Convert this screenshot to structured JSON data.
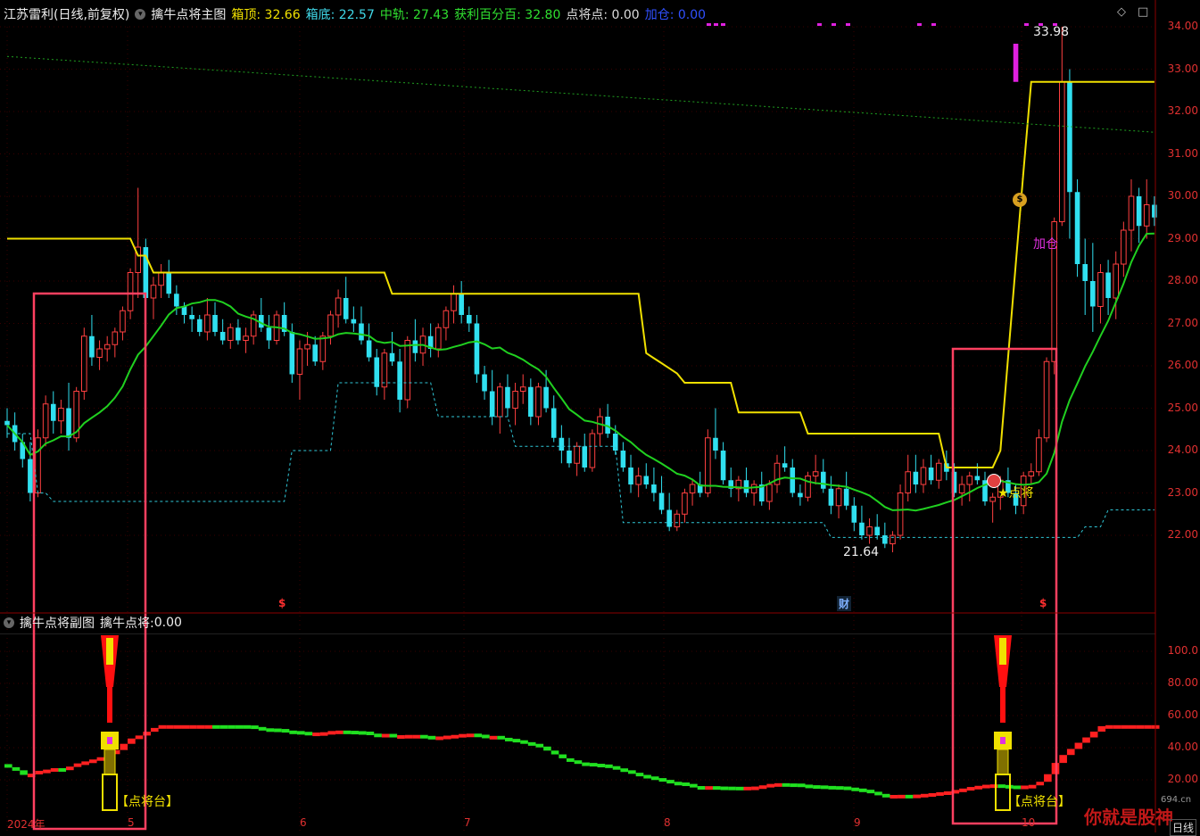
{
  "header": {
    "title": "江苏雷利(日线,前复权)",
    "indicator": "擒牛点将主图",
    "fields": [
      {
        "label": "箱顶: ",
        "value": "32.66",
        "color": "#f0e000"
      },
      {
        "label": "箱底: ",
        "value": "22.57",
        "color": "#40d8e8"
      },
      {
        "label": "中轨: ",
        "value": "27.43",
        "color": "#30e030"
      },
      {
        "label": "获利百分百: ",
        "value": "32.80",
        "color": "#30e030"
      },
      {
        "label": "点将点: ",
        "value": "0.00",
        "color": "#dddddd"
      },
      {
        "label": "加仓: ",
        "value": "0.00",
        "color": "#3050ff"
      }
    ]
  },
  "controls": {
    "diamond_icon": "◇",
    "square_icon": "□"
  },
  "sub": {
    "title": "擒牛点将副图",
    "field_label": "擒牛点将: ",
    "field_value": "0.00"
  },
  "annotations": {
    "high_label": "33.98",
    "low_label": "21.64",
    "dianjiang": "★点将",
    "jiacang": "加仓",
    "dianjiangtai_1": "【点将台】",
    "dianjiangtai_2": "【点将台】",
    "cai": "财",
    "dollar_1": "$",
    "dollar_2": "$",
    "coin_icon": "$"
  },
  "yaxis_main": [
    "34.00",
    "33.00",
    "32.00",
    "31.00",
    "30.00",
    "29.00",
    "28.00",
    "27.00",
    "26.00",
    "25.00",
    "24.00",
    "23.00",
    "22.00"
  ],
  "yaxis_sub": [
    "100.0",
    "80.00",
    "60.00",
    "40.00",
    "20.00"
  ],
  "xaxis": [
    {
      "label": "2024年"
    },
    {
      "label": "5"
    },
    {
      "label": "6"
    },
    {
      "label": "7"
    },
    {
      "label": "8"
    },
    {
      "label": "9"
    },
    {
      "label": "10"
    }
  ],
  "timeframe": "日线",
  "watermark": {
    "text": "你就是股神",
    "site": "694.cn"
  },
  "colors": {
    "up": "#ff4040",
    "down": "#30e0f0",
    "box_top": "#f0e000",
    "mid": "#20d020",
    "box_bottom": "#30c8d8",
    "grid": "#8b0000",
    "highlight": "#ff4060"
  },
  "chart_data": {
    "type": "candlestick",
    "ylim": [
      21.2,
      34.4
    ],
    "series": [
      {
        "name": "箱顶",
        "kind": "line"
      },
      {
        "name": "箱底",
        "kind": "line"
      },
      {
        "name": "中轨",
        "kind": "line"
      }
    ],
    "ohlc": [
      [
        24.7,
        25.0,
        24.3,
        24.6
      ],
      [
        24.6,
        24.9,
        24.0,
        24.2
      ],
      [
        24.2,
        24.4,
        23.6,
        23.8
      ],
      [
        23.8,
        24.2,
        22.8,
        23.0
      ],
      [
        23.0,
        24.5,
        22.9,
        24.3
      ],
      [
        24.3,
        25.3,
        24.1,
        25.1
      ],
      [
        25.1,
        25.4,
        24.4,
        24.7
      ],
      [
        24.7,
        25.2,
        24.4,
        25.0
      ],
      [
        25.0,
        25.6,
        24.0,
        24.3
      ],
      [
        24.3,
        25.5,
        24.2,
        25.4
      ],
      [
        25.4,
        26.9,
        25.2,
        26.7
      ],
      [
        26.7,
        27.2,
        26.0,
        26.2
      ],
      [
        26.2,
        26.6,
        25.9,
        26.4
      ],
      [
        26.4,
        26.7,
        26.1,
        26.5
      ],
      [
        26.5,
        26.9,
        26.2,
        26.8
      ],
      [
        26.8,
        27.4,
        26.6,
        27.3
      ],
      [
        27.3,
        28.3,
        27.1,
        28.2
      ],
      [
        28.2,
        30.2,
        27.6,
        28.8
      ],
      [
        28.8,
        29.0,
        27.2,
        27.6
      ],
      [
        27.6,
        28.1,
        27.1,
        27.9
      ],
      [
        27.9,
        28.4,
        27.6,
        28.2
      ],
      [
        28.2,
        28.5,
        27.6,
        27.7
      ],
      [
        27.7,
        27.9,
        27.2,
        27.4
      ],
      [
        27.4,
        27.5,
        27.0,
        27.2
      ],
      [
        27.2,
        27.4,
        26.8,
        27.1
      ],
      [
        27.1,
        27.2,
        26.7,
        26.8
      ],
      [
        26.8,
        27.6,
        26.6,
        27.2
      ],
      [
        27.2,
        27.5,
        26.7,
        26.8
      ],
      [
        26.8,
        27.1,
        26.5,
        26.6
      ],
      [
        26.6,
        27.0,
        26.4,
        26.9
      ],
      [
        26.9,
        27.1,
        26.5,
        26.6
      ],
      [
        26.6,
        26.9,
        26.3,
        26.7
      ],
      [
        26.7,
        27.3,
        26.5,
        27.2
      ],
      [
        27.2,
        27.6,
        26.8,
        26.9
      ],
      [
        26.9,
        27.2,
        26.4,
        26.6
      ],
      [
        26.6,
        27.3,
        26.5,
        27.2
      ],
      [
        27.2,
        27.5,
        26.7,
        26.8
      ],
      [
        26.8,
        27.0,
        25.6,
        25.8
      ],
      [
        25.8,
        26.6,
        25.2,
        26.4
      ],
      [
        26.4,
        26.8,
        26.0,
        26.5
      ],
      [
        26.5,
        26.7,
        26.0,
        26.1
      ],
      [
        26.1,
        26.8,
        25.9,
        26.7
      ],
      [
        26.7,
        27.3,
        26.5,
        27.2
      ],
      [
        27.2,
        27.8,
        26.9,
        27.6
      ],
      [
        27.6,
        28.1,
        27.0,
        27.1
      ],
      [
        27.1,
        27.4,
        26.8,
        27.0
      ],
      [
        27.0,
        27.4,
        26.5,
        26.6
      ],
      [
        26.6,
        27.0,
        26.1,
        26.2
      ],
      [
        26.2,
        26.4,
        25.3,
        25.5
      ],
      [
        25.5,
        26.4,
        25.2,
        26.3
      ],
      [
        26.3,
        26.8,
        26.0,
        26.1
      ],
      [
        26.1,
        26.4,
        24.9,
        25.2
      ],
      [
        25.2,
        26.7,
        25.0,
        26.6
      ],
      [
        26.6,
        27.1,
        26.1,
        26.3
      ],
      [
        26.3,
        26.9,
        26.0,
        26.7
      ],
      [
        26.7,
        27.0,
        26.2,
        26.4
      ],
      [
        26.4,
        27.0,
        26.2,
        26.9
      ],
      [
        26.9,
        27.4,
        26.6,
        27.3
      ],
      [
        27.3,
        27.9,
        27.0,
        27.7
      ],
      [
        27.7,
        28.0,
        27.0,
        27.2
      ],
      [
        27.2,
        27.4,
        26.8,
        27.0
      ],
      [
        27.0,
        27.2,
        25.6,
        25.8
      ],
      [
        25.8,
        26.0,
        25.2,
        25.4
      ],
      [
        25.4,
        25.9,
        24.6,
        24.8
      ],
      [
        24.8,
        25.6,
        24.4,
        25.5
      ],
      [
        25.5,
        25.8,
        24.8,
        25.0
      ],
      [
        25.0,
        25.6,
        24.6,
        25.4
      ],
      [
        25.4,
        25.8,
        25.1,
        25.5
      ],
      [
        25.5,
        25.7,
        24.6,
        24.8
      ],
      [
        24.8,
        25.6,
        24.6,
        25.5
      ],
      [
        25.5,
        25.9,
        24.9,
        25.0
      ],
      [
        25.0,
        25.3,
        24.2,
        24.3
      ],
      [
        24.3,
        24.6,
        23.7,
        24.0
      ],
      [
        24.0,
        24.3,
        23.6,
        23.7
      ],
      [
        23.7,
        24.2,
        23.4,
        24.1
      ],
      [
        24.1,
        24.4,
        23.5,
        23.6
      ],
      [
        23.6,
        24.5,
        23.5,
        24.4
      ],
      [
        24.4,
        25.0,
        24.1,
        24.8
      ],
      [
        24.8,
        25.1,
        24.3,
        24.4
      ],
      [
        24.4,
        24.6,
        23.9,
        24.0
      ],
      [
        24.0,
        24.2,
        23.5,
        23.6
      ],
      [
        23.6,
        23.9,
        23.0,
        23.2
      ],
      [
        23.2,
        23.6,
        22.9,
        23.4
      ],
      [
        23.4,
        23.7,
        23.1,
        23.2
      ],
      [
        23.2,
        23.6,
        22.8,
        23.0
      ],
      [
        23.0,
        23.4,
        22.5,
        22.6
      ],
      [
        22.6,
        23.0,
        22.1,
        22.2
      ],
      [
        22.2,
        22.6,
        22.1,
        22.5
      ],
      [
        22.5,
        23.1,
        22.3,
        23.0
      ],
      [
        23.0,
        23.3,
        22.7,
        23.2
      ],
      [
        23.2,
        23.5,
        22.9,
        23.0
      ],
      [
        23.0,
        24.5,
        22.9,
        24.3
      ],
      [
        24.3,
        25.0,
        23.8,
        24.0
      ],
      [
        24.0,
        24.2,
        23.2,
        23.3
      ],
      [
        23.3,
        23.6,
        22.9,
        23.1
      ],
      [
        23.1,
        23.4,
        22.8,
        23.3
      ],
      [
        23.3,
        23.6,
        22.9,
        23.0
      ],
      [
        23.0,
        23.3,
        22.7,
        23.2
      ],
      [
        23.2,
        23.5,
        22.7,
        22.8
      ],
      [
        22.8,
        23.3,
        22.6,
        23.2
      ],
      [
        23.2,
        23.9,
        23.0,
        23.7
      ],
      [
        23.7,
        24.1,
        23.5,
        23.6
      ],
      [
        23.6,
        23.8,
        22.9,
        23.0
      ],
      [
        23.0,
        23.2,
        22.7,
        22.9
      ],
      [
        22.9,
        23.5,
        22.8,
        23.4
      ],
      [
        23.4,
        23.9,
        23.2,
        23.5
      ],
      [
        23.5,
        23.8,
        23.0,
        23.1
      ],
      [
        23.1,
        23.4,
        22.5,
        22.7
      ],
      [
        22.7,
        23.2,
        22.4,
        23.1
      ],
      [
        23.1,
        23.5,
        22.6,
        22.7
      ],
      [
        22.7,
        22.9,
        22.1,
        22.3
      ],
      [
        22.3,
        22.7,
        21.9,
        22.0
      ],
      [
        22.0,
        22.4,
        21.8,
        22.2
      ],
      [
        22.2,
        22.5,
        21.9,
        22.0
      ],
      [
        22.0,
        22.3,
        21.7,
        21.8
      ],
      [
        21.8,
        22.1,
        21.6,
        22.0
      ],
      [
        22.0,
        23.2,
        21.9,
        23.0
      ],
      [
        23.0,
        23.9,
        22.8,
        23.5
      ],
      [
        23.5,
        23.9,
        23.0,
        23.2
      ],
      [
        23.2,
        23.8,
        23.0,
        23.6
      ],
      [
        23.6,
        23.9,
        23.2,
        23.3
      ],
      [
        23.3,
        23.8,
        23.1,
        23.7
      ],
      [
        23.7,
        24.0,
        23.3,
        23.5
      ],
      [
        23.5,
        23.7,
        22.9,
        23.0
      ],
      [
        23.0,
        23.4,
        22.7,
        23.2
      ],
      [
        23.2,
        23.5,
        22.8,
        23.4
      ],
      [
        23.4,
        23.7,
        23.2,
        23.3
      ],
      [
        23.3,
        23.5,
        22.7,
        22.8
      ],
      [
        22.8,
        23.0,
        22.3,
        22.9
      ],
      [
        22.9,
        23.4,
        22.6,
        23.3
      ],
      [
        23.3,
        23.6,
        22.9,
        23.0
      ],
      [
        23.0,
        23.2,
        22.5,
        22.7
      ],
      [
        22.7,
        23.5,
        22.5,
        23.4
      ],
      [
        23.4,
        23.7,
        23.2,
        23.5
      ],
      [
        23.5,
        24.5,
        23.4,
        24.3
      ],
      [
        24.3,
        26.2,
        24.2,
        26.1
      ],
      [
        26.1,
        29.5,
        25.8,
        29.4
      ],
      [
        29.4,
        34.0,
        29.3,
        32.7
      ],
      [
        32.7,
        33.0,
        29.0,
        30.1
      ],
      [
        30.1,
        30.4,
        28.1,
        28.4
      ],
      [
        28.4,
        29.0,
        27.2,
        28.0
      ],
      [
        28.0,
        28.9,
        26.8,
        27.4
      ],
      [
        27.4,
        28.4,
        27.0,
        28.2
      ],
      [
        28.2,
        28.5,
        27.2,
        27.6
      ],
      [
        27.6,
        28.7,
        27.1,
        28.4
      ],
      [
        28.4,
        29.4,
        28.1,
        29.2
      ],
      [
        29.2,
        30.4,
        28.7,
        30.0
      ],
      [
        30.0,
        30.2,
        28.9,
        29.3
      ],
      [
        29.3,
        30.4,
        29.0,
        29.8
      ],
      [
        29.8,
        30.0,
        29.3,
        29.5
      ]
    ]
  }
}
